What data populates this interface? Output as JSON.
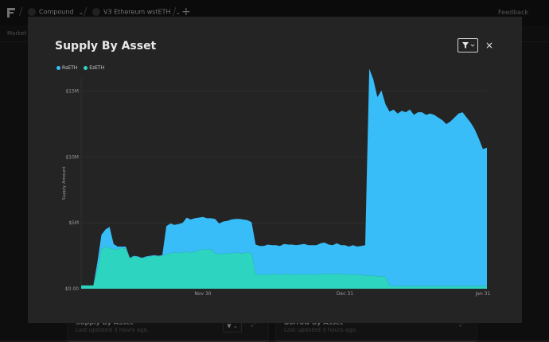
{
  "topbar": {
    "crumb1": "Compound",
    "crumb2": "V3 Ethereum wstETH",
    "feedback": "Feedback"
  },
  "subnav": {
    "label": "Market"
  },
  "bg_cards": [
    {
      "title": "Supply By Asset",
      "updated": "Last updated 3 hours ago."
    },
    {
      "title": "Borrow By Asset",
      "updated": "Last updated 3 hours ago."
    }
  ],
  "modal": {
    "title": "Supply By Asset",
    "close": "×"
  },
  "legend": [
    {
      "label": "RsETH",
      "color": "#38bdf8"
    },
    {
      "label": "EzETH",
      "color": "#2dd4bf"
    }
  ],
  "chart_data": {
    "type": "area",
    "stacked": true,
    "ylabel": "Supply Amount",
    "ylim": [
      0,
      16000000
    ],
    "yticks": [
      0,
      5000000,
      10000000,
      15000000
    ],
    "ytick_labels": [
      "$0.00",
      "$5M",
      "$10M",
      "$15M"
    ],
    "xlim": [
      0,
      100
    ],
    "xticks": [
      30,
      65,
      99
    ],
    "xtick_labels": [
      "Nov 30",
      "Dec 31",
      "Jan 31"
    ],
    "grid": true,
    "legend_position": "top-left",
    "x": [
      0,
      3,
      4,
      5,
      6,
      7,
      8,
      9,
      10,
      11,
      12,
      13,
      14,
      15,
      16,
      17,
      18,
      19,
      20,
      21,
      22,
      23,
      24,
      25,
      26,
      27,
      28,
      29,
      30,
      31,
      32,
      33,
      34,
      35,
      36,
      37,
      38,
      39,
      40,
      41,
      42,
      43,
      44,
      45,
      46,
      47,
      48,
      49,
      50,
      51,
      52,
      53,
      54,
      55,
      56,
      57,
      58,
      59,
      60,
      61,
      62,
      63,
      64,
      65,
      66,
      67,
      68,
      69,
      70,
      71,
      72,
      73,
      74,
      75,
      76,
      77,
      78,
      79,
      80,
      81,
      82,
      83,
      84,
      85,
      86,
      87,
      88,
      89,
      90,
      91,
      92,
      93,
      94,
      95,
      96,
      97,
      98,
      99,
      100
    ],
    "series": [
      {
        "name": "EzETH",
        "color": "#2dd4bf",
        "values": [
          0.25,
          0.25,
          1.5,
          3.0,
          3.2,
          3.1,
          3.0,
          3.0,
          3.1,
          3.05,
          2.3,
          2.45,
          2.4,
          2.3,
          2.4,
          2.45,
          2.5,
          2.45,
          2.5,
          2.6,
          2.7,
          2.75,
          2.7,
          2.75,
          2.8,
          2.75,
          2.8,
          2.9,
          3.0,
          2.95,
          3.0,
          2.7,
          2.6,
          2.7,
          2.65,
          2.7,
          2.75,
          2.7,
          2.7,
          2.75,
          2.7,
          1.1,
          1.05,
          1.1,
          1.05,
          1.1,
          1.1,
          1.05,
          1.1,
          1.1,
          1.05,
          1.1,
          1.1,
          1.05,
          1.1,
          1.1,
          1.05,
          1.1,
          1.15,
          1.1,
          1.1,
          1.15,
          1.1,
          1.1,
          1.05,
          1.1,
          1.05,
          1.05,
          1.0,
          1.0,
          1.0,
          0.95,
          0.95,
          0.9,
          0.25,
          0.2,
          0.2,
          0.2,
          0.2,
          0.2,
          0.2,
          0.2,
          0.2,
          0.2,
          0.2,
          0.2,
          0.2,
          0.2,
          0.2,
          0.2,
          0.2,
          0.2,
          0.2,
          0.2,
          0.2,
          0.2,
          0.2,
          0.2,
          0.2
        ]
      },
      {
        "name": "RsETH",
        "color": "#38bdf8",
        "values": [
          0.0,
          0.0,
          0.5,
          1.1,
          1.3,
          1.6,
          0.4,
          0.2,
          0.1,
          0.15,
          0.05,
          0.05,
          0.05,
          0.05,
          0.05,
          0.05,
          0.05,
          0.05,
          0.05,
          2.15,
          2.25,
          2.1,
          2.2,
          2.25,
          2.6,
          2.5,
          2.55,
          2.5,
          2.45,
          2.4,
          2.35,
          2.6,
          2.35,
          2.4,
          2.5,
          2.55,
          2.55,
          2.6,
          2.55,
          2.45,
          2.35,
          2.25,
          2.2,
          2.15,
          2.3,
          2.2,
          2.2,
          2.2,
          2.3,
          2.25,
          2.3,
          2.2,
          2.25,
          2.35,
          2.2,
          2.2,
          2.25,
          2.35,
          2.35,
          2.25,
          2.2,
          2.3,
          2.2,
          2.2,
          2.15,
          2.2,
          2.15,
          2.2,
          2.3,
          15.7,
          14.9,
          13.6,
          14.1,
          13.1,
          13.2,
          13.4,
          13.1,
          13.3,
          13.2,
          13.4,
          13.0,
          13.2,
          13.2,
          13.0,
          13.1,
          13.0,
          12.8,
          12.6,
          12.3,
          12.5,
          12.8,
          13.1,
          13.2,
          12.8,
          12.4,
          11.9,
          11.2,
          10.4,
          10.5
        ]
      }
    ]
  }
}
